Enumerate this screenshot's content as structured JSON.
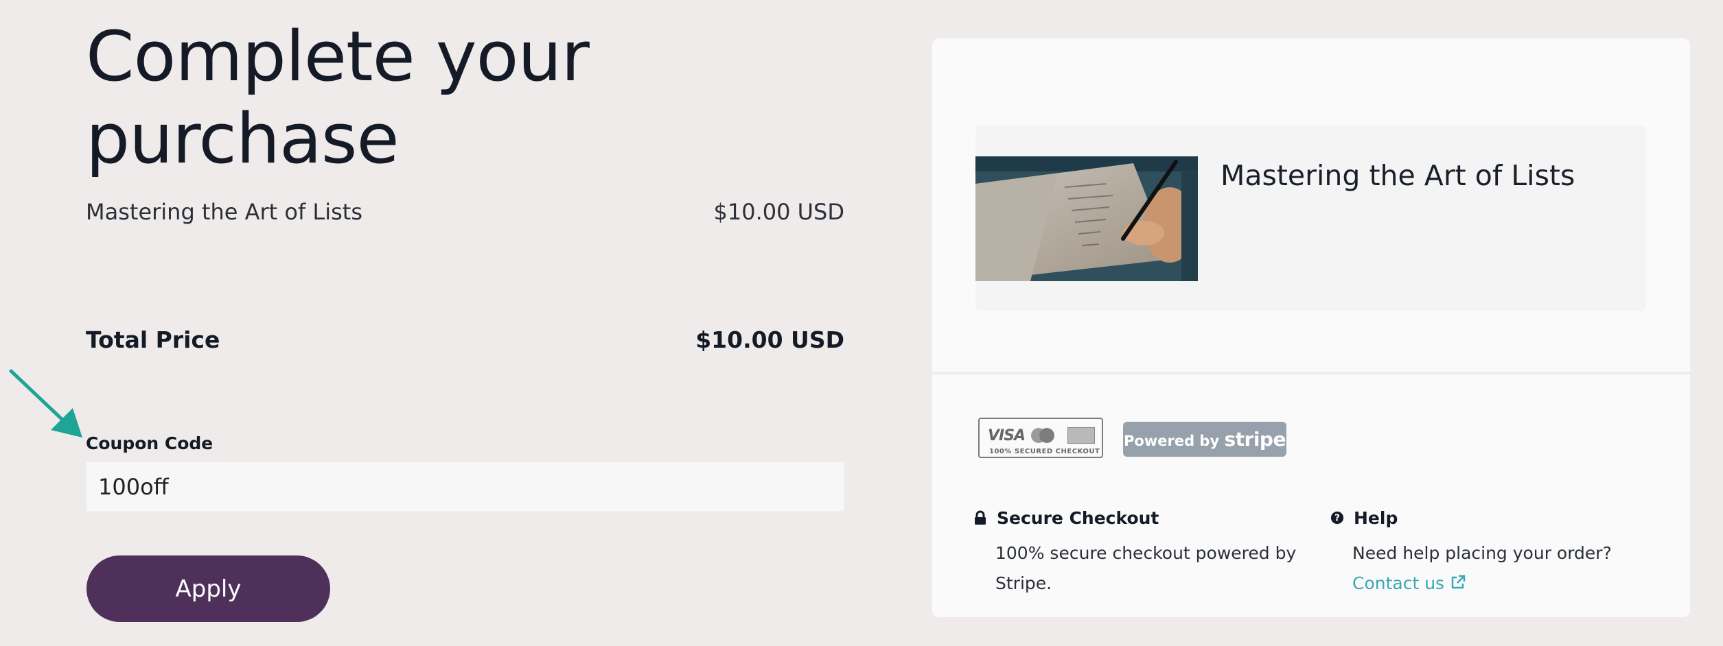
{
  "page": {
    "title": "Complete your purchase"
  },
  "order": {
    "item_name": "Mastering the Art of Lists",
    "item_price": "$10.00 USD",
    "total_label": "Total Price",
    "total_value": "$10.00 USD"
  },
  "coupon": {
    "label": "Coupon Code",
    "value": "100off",
    "apply_label": "Apply"
  },
  "summary_card": {
    "product_title": "Mastering the Art of Lists",
    "payment_badge": {
      "visa_text": "VISA",
      "secured_text": "100% SECURED CHECKOUT"
    },
    "stripe_badge": {
      "prefix": "Powered by",
      "brand": "stripe"
    },
    "secure_checkout": {
      "icon": "lock-icon",
      "heading": "Secure Checkout",
      "body": "100% secure checkout powered by Stripe."
    },
    "help": {
      "icon": "question-circle-icon",
      "heading": "Help",
      "body": "Need help placing your order?",
      "link_label": "Contact us",
      "link_icon": "external-link-icon"
    }
  },
  "colors": {
    "background": "#efebeb",
    "apply_button": "#4f305a",
    "link": "#3aa8b4",
    "arrow": "#1fa597",
    "stripe_badge": "#97a1ab"
  }
}
